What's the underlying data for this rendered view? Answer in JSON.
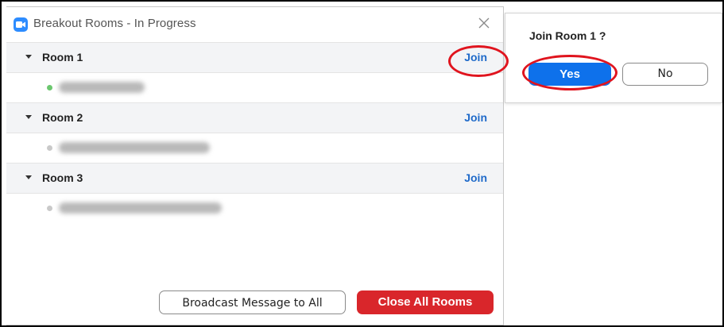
{
  "window": {
    "title": "Breakout Rooms - In Progress",
    "app_icon": "zoom-camera-icon",
    "close_icon": "close-icon"
  },
  "rooms": [
    {
      "name": "Room 1",
      "join_label": "Join",
      "participant_status": "green"
    },
    {
      "name": "Room 2",
      "join_label": "Join",
      "participant_status": "gray"
    },
    {
      "name": "Room 3",
      "join_label": "Join",
      "participant_status": "gray"
    }
  ],
  "footer": {
    "broadcast_label": "Broadcast Message to All",
    "close_all_label": "Close All Rooms"
  },
  "dialog": {
    "question": "Join Room 1 ?",
    "yes_label": "Yes",
    "no_label": "No"
  },
  "colors": {
    "accent_blue": "#0e71eb",
    "link_blue": "#1f6ac9",
    "danger_red": "#d9262b",
    "annotation_red": "#e0141e",
    "online_green": "#6cc76f"
  }
}
